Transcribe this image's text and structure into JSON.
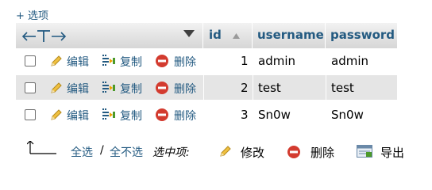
{
  "options_link": "+ 选项",
  "columns": [
    "id",
    "username",
    "password"
  ],
  "actions": {
    "edit": "编辑",
    "copy": "复制",
    "delete": "删除"
  },
  "rows": [
    {
      "id": "1",
      "username": "admin",
      "password": "admin"
    },
    {
      "id": "2",
      "username": "test",
      "password": "test"
    },
    {
      "id": "3",
      "username": "Sn0w",
      "password": "Sn0w"
    }
  ],
  "footer": {
    "check_all": "全选",
    "separator": "/",
    "uncheck_all": "全不选",
    "with_selected": "选中项:",
    "edit": "修改",
    "delete": "删除",
    "export": "导出"
  },
  "colors": {
    "link": "#235a81",
    "delete_red": "#d33b2f",
    "header_bg": "#dcdcdc",
    "stripe": "#e5e5e5"
  },
  "icons": [
    "left-right-arrow-icon",
    "sort-dropdown-icon",
    "sort-asc-icon",
    "pencil-icon",
    "copy-icon",
    "delete-icon",
    "checkall-arrow-icon",
    "export-icon"
  ]
}
